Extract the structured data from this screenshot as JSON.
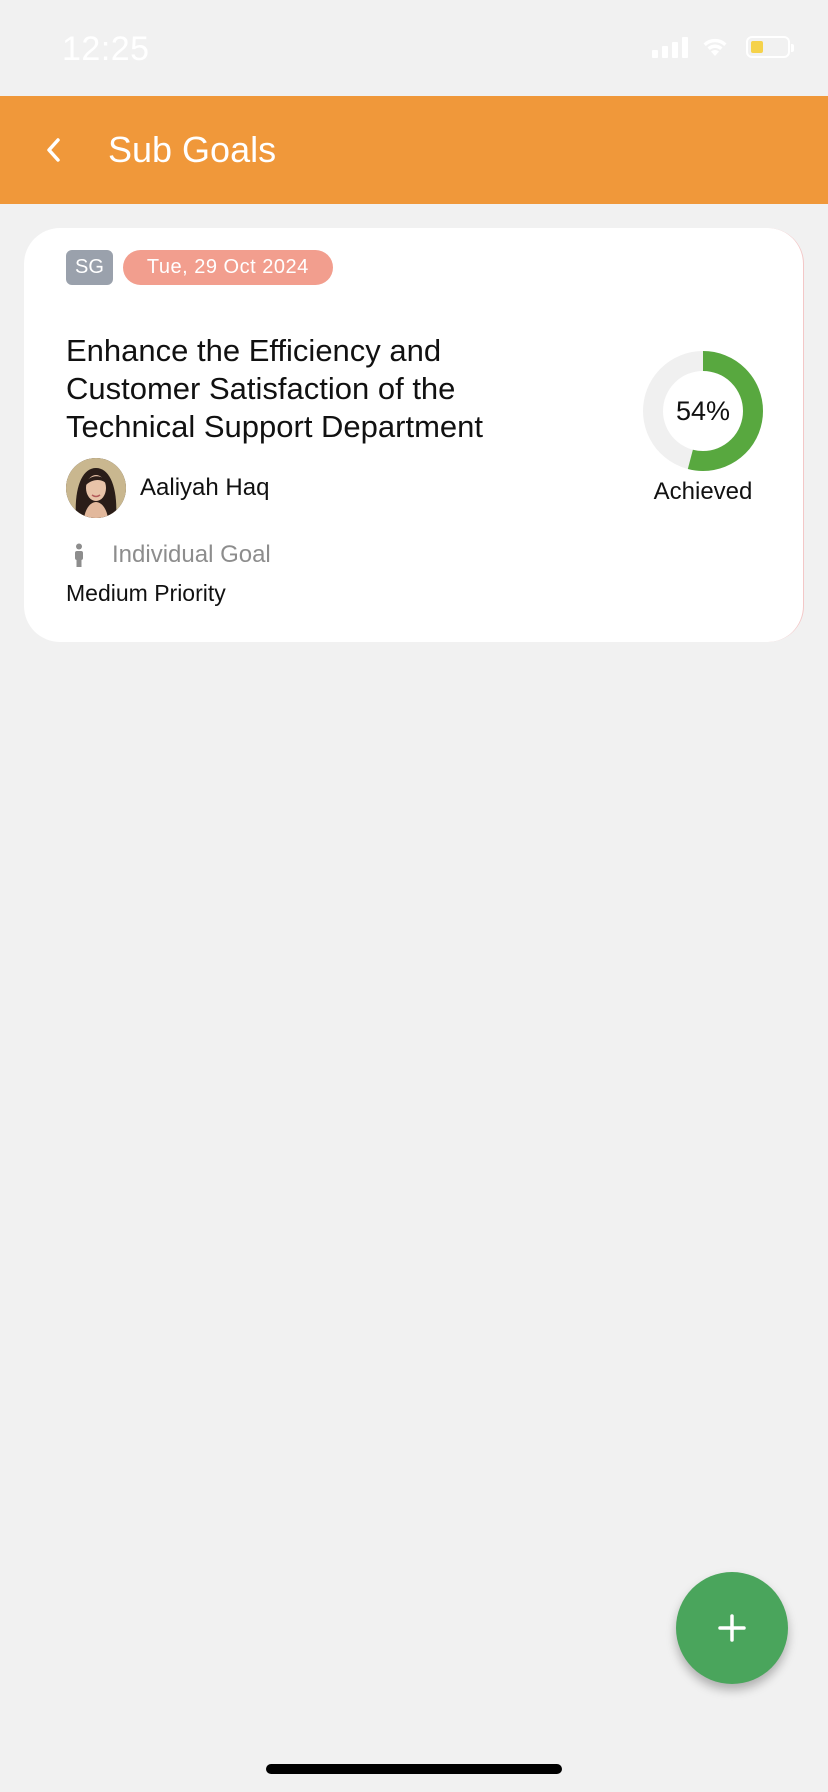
{
  "status_bar": {
    "time": "12:25"
  },
  "header": {
    "title": "Sub Goals"
  },
  "goal": {
    "code_badge": "SG",
    "date": "Tue, 29 Oct 2024",
    "title": "Enhance the Efficiency and Customer Satisfaction of the Technical Support Department",
    "owner_name": "Aaliyah Haq",
    "goal_type": "Individual Goal",
    "priority": "Medium Priority",
    "progress_text": "54%",
    "progress_value": 0.54,
    "progress_label": "Achieved"
  },
  "colors": {
    "header_bg": "#f0983a",
    "progress_color": "#58a83f",
    "date_badge": "#f29e8e",
    "fab": "#4aa55c"
  },
  "icons": {
    "back": "chevron-left-icon",
    "person": "person-icon",
    "add": "plus-icon"
  }
}
